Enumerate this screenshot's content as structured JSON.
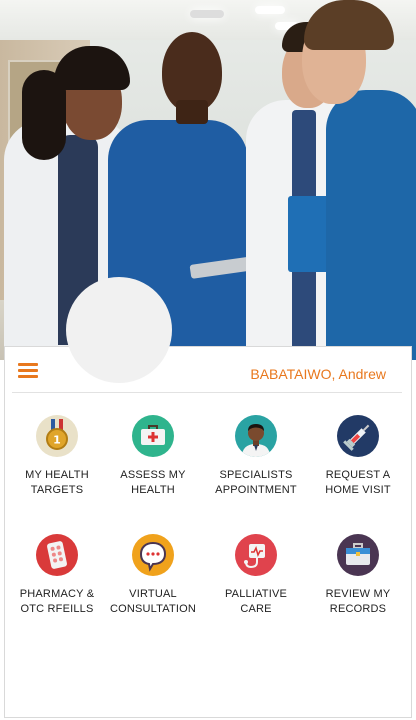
{
  "user": {
    "name": "BABATAIWO, Andrew"
  },
  "menu": {
    "icon": "hamburger-menu-icon"
  },
  "tiles": [
    {
      "line1": "MY HEALTH",
      "line2": "TARGETS",
      "icon": "medal-icon",
      "color": "#e9e1c8"
    },
    {
      "line1": "ASSESS MY",
      "line2": "HEALTH",
      "icon": "first-aid-kit-icon",
      "color": "#2fb48d"
    },
    {
      "line1": "SPECIALISTS",
      "line2": "APPOINTMENT",
      "icon": "doctor-icon",
      "color": "#2aa3a3"
    },
    {
      "line1": "REQUEST A",
      "line2": "HOME VISIT",
      "icon": "syringe-icon",
      "color": "#223a66"
    },
    {
      "line1": "PHARMACY &",
      "line2": "OTC RFEILLS",
      "icon": "pills-icon",
      "color": "#d93a3a"
    },
    {
      "line1": "VIRTUAL",
      "line2": "CONSULTATION",
      "icon": "chat-bubble-icon",
      "color": "#f0a21c"
    },
    {
      "line1": "PALLIATIVE",
      "line2": "CARE",
      "icon": "heart-monitor-icon",
      "color": "#e0434d"
    },
    {
      "line1": "REVIEW MY",
      "line2": "RECORDS",
      "icon": "briefcase-icon",
      "color": "#4a3552"
    }
  ],
  "colors": {
    "accent": "#e8781e"
  }
}
